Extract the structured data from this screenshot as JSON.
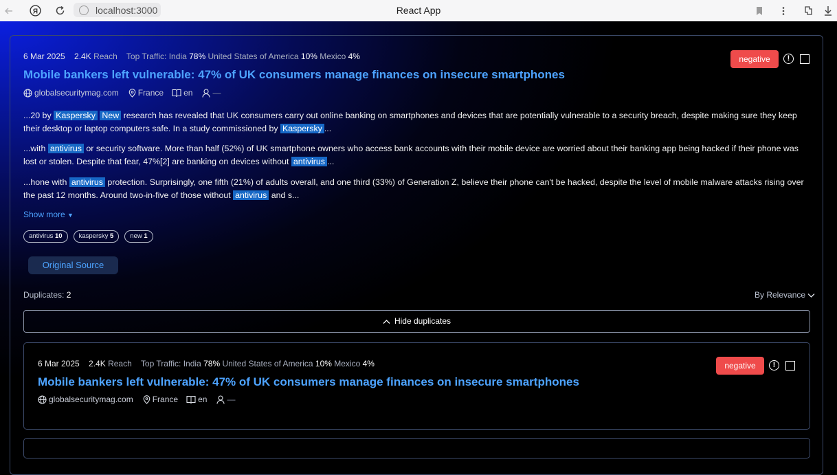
{
  "browser": {
    "url": "localhost:3000",
    "tab_title": "React App",
    "back_icon": "arrow-left-icon",
    "yandex_icon": "yandex-logo-icon",
    "reload_icon": "reload-icon"
  },
  "article": {
    "date": "6 Mar 2025",
    "reach_value": "2.4K",
    "reach_label": "Reach",
    "top_traffic_label": "Top Traffic:",
    "traffic": [
      {
        "country": "India",
        "pct": "78%"
      },
      {
        "country": "United States of America",
        "pct": "10%"
      },
      {
        "country": "Mexico",
        "pct": "4%"
      }
    ],
    "title": "Mobile bankers left vulnerable: 47% of UK consumers manage finances on insecure smartphones",
    "domain": "globalsecuritymag.com",
    "country": "France",
    "language": "en",
    "author": "—",
    "sentiment": "negative",
    "snippets": [
      {
        "p1": "...20 by ",
        "h1": "Kaspersky",
        "h2": "New",
        "p2": " research has revealed that UK consumers carry out online banking on smartphones and devices that are potentially vulnerable to a security breach, despite making sure they keep their desktop or laptop computers safe. In a study commissioned by ",
        "h3": "Kaspersky",
        "p3": "..."
      },
      {
        "p1": "...with ",
        "h1": "antivirus",
        "p2": " or security software. More than half (52%) of UK smartphone owners who access bank accounts with their mobile device are worried about their banking app being hacked if their phone was lost or stolen. Despite that fear, 47%[2] are banking on devices without ",
        "h2": "antivirus",
        "p3": "..."
      },
      {
        "p1": "...hone with ",
        "h1": "antivirus",
        "p2": " protection. Surprisingly, one fifth (21%) of adults overall, and one third (33%) of Generation Z, believe their phone can't be hacked, despite the level of mobile malware attacks rising over the past 12 months. Around two-in-five of those without ",
        "h2": "antivirus",
        "p3": " and s..."
      }
    ],
    "show_more": "Show more",
    "tags": [
      {
        "name": "antivirus",
        "count": "10"
      },
      {
        "name": "kaspersky",
        "count": "5"
      },
      {
        "name": "new",
        "count": "1"
      }
    ],
    "original_source": "Original Source",
    "duplicates_label": "Duplicates:",
    "duplicates_count": "2",
    "sort_label": "By Relevance",
    "hide_duplicates": "Hide duplicates"
  },
  "duplicate": {
    "date": "6 Mar 2025",
    "reach_value": "2.4K",
    "reach_label": "Reach",
    "top_traffic_label": "Top Traffic:",
    "traffic": [
      {
        "country": "India",
        "pct": "78%"
      },
      {
        "country": "United States of America",
        "pct": "10%"
      },
      {
        "country": "Mexico",
        "pct": "4%"
      }
    ],
    "title": "Mobile bankers left vulnerable: 47% of UK consumers manage finances on insecure smartphones",
    "domain": "globalsecuritymag.com",
    "country": "France",
    "language": "en",
    "author": "—",
    "sentiment": "negative"
  },
  "colors": {
    "accent": "#4da3ff",
    "negative": "#ef4b4b",
    "highlight": "#1768c6"
  }
}
